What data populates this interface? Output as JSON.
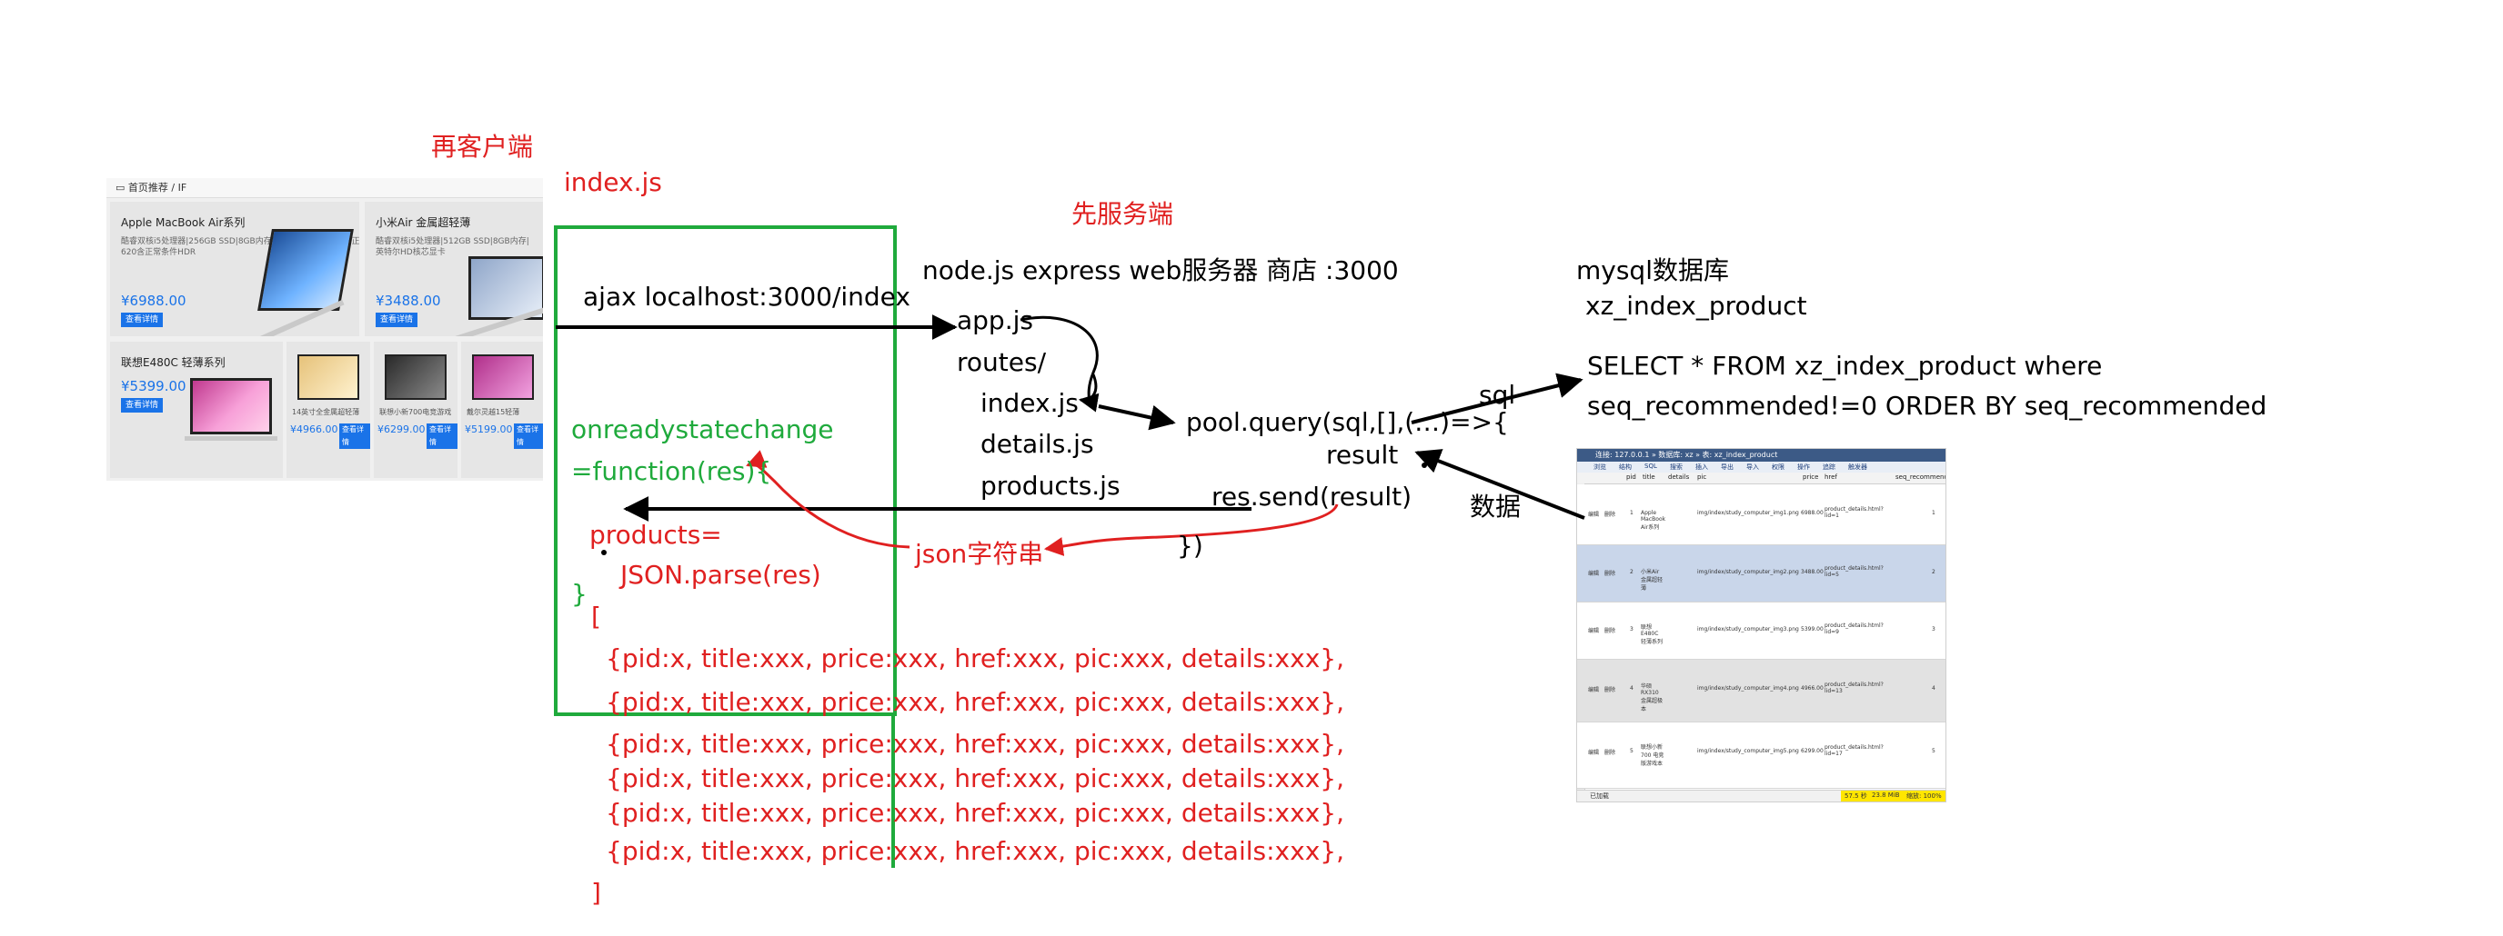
{
  "labels": {
    "client": "再客户端",
    "index_js": "index.js",
    "server_first": "先服务端",
    "node": "node.js express web服务器 商店 :3000",
    "mysql": "mysql数据库",
    "table": "xz_index_product",
    "ajax": "ajax localhost:3000/index",
    "app": "app.js",
    "routes": "routes/",
    "route_index": "index.js",
    "route_details": "details.js",
    "route_products": "products.js",
    "pool": "pool.query(sql,[],(…)=>{",
    "result": "result",
    "sql_label": "sql",
    "data_label": "数据",
    "query_line1": "SELECT * FROM xz_index_product where",
    "query_line2": "seq_recommended!=0 ORDER BY  seq_recommended",
    "res_send": "res.send(result)",
    "close_paren": "})",
    "json_string": "json字符串",
    "onready": "onreadystatechange",
    "func": "=function(res){",
    "products_assign": "products=",
    "json_parse": "JSON.parse(res)",
    "close_brace": "}",
    "open_bracket": "[",
    "close_bracket": "]",
    "row_text": "{pid:x, title:xxx, price:xxx, href:xxx, pic:xxx, details:xxx},"
  },
  "array_rows": [
    "{pid:x, title:xxx, price:xxx, href:xxx, pic:xxx, details:xxx},",
    "{pid:x, title:xxx, price:xxx, href:xxx, pic:xxx, details:xxx},",
    "{pid:x, title:xxx, price:xxx, href:xxx, pic:xxx, details:xxx},",
    "{pid:x, title:xxx, price:xxx, href:xxx, pic:xxx, details:xxx},",
    "{pid:x, title:xxx, price:xxx, href:xxx, pic:xxx, details:xxx},",
    "{pid:x, title:xxx, price:xxx, href:xxx, pic:xxx, details:xxx},"
  ],
  "shop": {
    "header": "首页推荐 / IF",
    "card1_title": "Apple MacBook Air系列",
    "card1_desc": "酷睿双核i5处理器|256GB SSD|8GB内存|英特尔HD显卡620含正",
    "card1_desc2": "620含正常条件HDR",
    "card1_price": "¥6988.00",
    "card2_title": "小米Air 金属超轻薄",
    "card2_desc": "酷睿双核i5处理器|512GB SSD|8GB内存|",
    "card2_desc2": "英特尔HD核芯显卡",
    "card2_price": "¥3488.00",
    "card3_title": "联想E480C 轻薄系列",
    "card3_price": "¥5399.00",
    "button": "查看详情",
    "mini_button": "查看详情",
    "mini": [
      {
        "text": "14英寸全金属超轻薄",
        "price": "¥4966.00"
      },
      {
        "text": "联想小新700电竞游戏",
        "price": "¥6299.00"
      },
      {
        "text": "戴尔灵越15轻薄",
        "price": "¥5199.00"
      }
    ]
  },
  "db": {
    "title": "连接: 127.0.0.1 » 数据库: xz » 表: xz_index_product",
    "tools": [
      "浏览",
      "结构",
      "SQL",
      "搜索",
      "插入",
      "导出",
      "导入",
      "权限",
      "操作",
      "追踪",
      "触发器"
    ],
    "columns": [
      "pid",
      "title",
      "details",
      "pic",
      "price",
      "href",
      "seq_recommended"
    ],
    "rows": [
      {
        "pid": "1",
        "title": "Apple MacBook Air系列",
        "pic": "img/index/study_computer_img1.png",
        "price": "6988.00",
        "href": "product_details.html?lid=1",
        "seq": "1"
      },
      {
        "pid": "2",
        "title": "小米Air 金属超轻薄",
        "pic": "img/index/study_computer_img2.png",
        "price": "3488.00",
        "href": "product_details.html?lid=5",
        "seq": "2"
      },
      {
        "pid": "3",
        "title": "联想E480C 轻薄系列",
        "pic": "img/index/study_computer_img3.png",
        "price": "5399.00",
        "href": "product_details.html?lid=9",
        "seq": "3"
      },
      {
        "pid": "4",
        "title": "华硕 RX310 金属超极本",
        "pic": "img/index/study_computer_img4.png",
        "price": "4966.00",
        "href": "product_details.html?lid=13",
        "seq": "4"
      },
      {
        "pid": "5",
        "title": "联想小新700 电竞版游戏本",
        "pic": "img/index/study_computer_img5.png",
        "price": "6299.00",
        "href": "product_details.html?lid=17",
        "seq": "5"
      }
    ],
    "row_actions": [
      "编辑",
      "复制",
      "删除"
    ],
    "status_left": "已加载",
    "status_count": "57.5 秒",
    "status_size": "23.8 MiB",
    "status_zoom": "缩放: 100%"
  }
}
